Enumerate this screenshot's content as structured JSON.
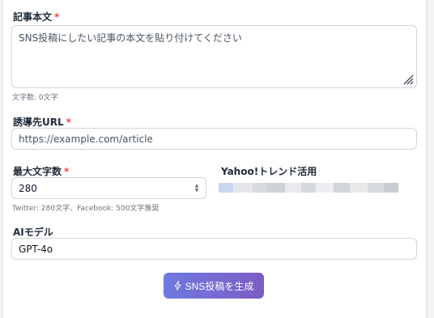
{
  "article_body": {
    "label": "記事本文",
    "required_mark": "*",
    "placeholder": "SNS投稿にしたい記事の本文を貼り付けてください",
    "char_count": "文字数: 0文字"
  },
  "target_url": {
    "label": "誘導先URL",
    "required_mark": "*",
    "placeholder": "https://example.com/article"
  },
  "max_chars": {
    "label": "最大文字数",
    "required_mark": "*",
    "value": "280",
    "hint": "Twitter: 280文字、Facebook: 500文字推奨"
  },
  "yahoo_trend": {
    "label": "Yahoo!トレンド活用"
  },
  "ai_model": {
    "label": "AIモデル",
    "value": "GPT-4o"
  },
  "generate_button": {
    "icon": "lightning-icon",
    "label": "SNS投稿を生成"
  },
  "colors": {
    "required": "#ef4444",
    "button_start": "#6d7ae0",
    "button_end": "#7c5cc4"
  }
}
